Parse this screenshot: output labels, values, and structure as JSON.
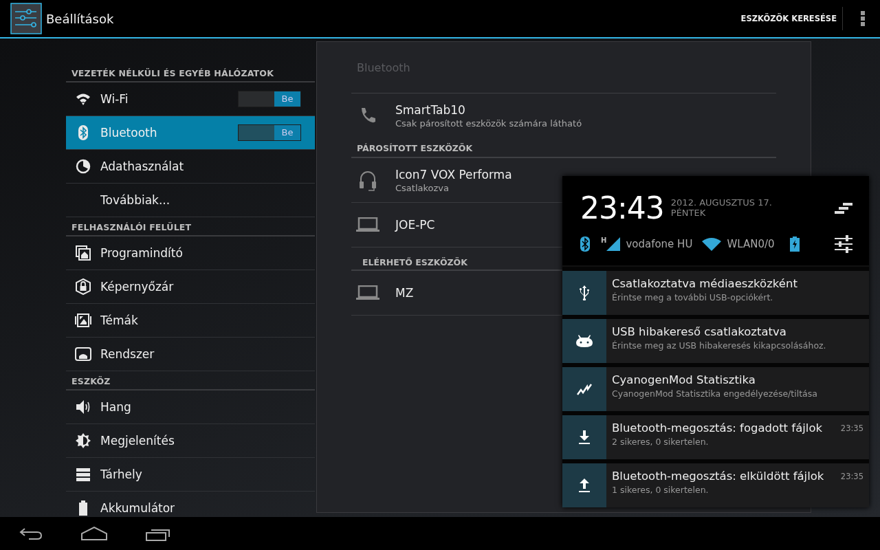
{
  "action_bar": {
    "title": "Beállítások",
    "action": "ESZKÖZÖK KERESÉSE"
  },
  "sidebar": [
    {
      "kind": "header",
      "label": "VEZETÉK NÉLKÜLI ÉS EGYÉB HÁLÓZATOK"
    },
    {
      "kind": "item",
      "label": "Wi-Fi",
      "selected": false,
      "switch": {
        "label": "Be",
        "on": true
      }
    },
    {
      "kind": "item",
      "label": "Bluetooth",
      "selected": true,
      "switch": {
        "label": "Be",
        "on": true
      }
    },
    {
      "kind": "item",
      "label": "Adathasználat",
      "selected": false
    },
    {
      "kind": "item",
      "label": "Továbbiak...",
      "selected": false
    },
    {
      "kind": "header",
      "label": "FELHASZNÁLÓI FELÜLET"
    },
    {
      "kind": "item",
      "label": "Programindító",
      "selected": false
    },
    {
      "kind": "item",
      "label": "Képernyőzár",
      "selected": false
    },
    {
      "kind": "item",
      "label": "Témák",
      "selected": false
    },
    {
      "kind": "item",
      "label": "Rendszer",
      "selected": false
    },
    {
      "kind": "header",
      "label": "ESZKÖZ"
    },
    {
      "kind": "item",
      "label": "Hang",
      "selected": false
    },
    {
      "kind": "item",
      "label": "Megjelenítés",
      "selected": false
    },
    {
      "kind": "item",
      "label": "Tárhely",
      "selected": false
    },
    {
      "kind": "item",
      "label": "Akkumulátor",
      "selected": false
    }
  ],
  "detail": {
    "title": "Bluetooth",
    "own_device": {
      "name": "SmartTab10",
      "status": "Csak párosított eszközök számára látható"
    },
    "sections": [
      {
        "header": "PÁROSÍTOTT ESZKÖZÖK",
        "devices": [
          {
            "name": "Icon7 VOX Performa",
            "status": "Csatlakozva"
          },
          {
            "name": "JOE-PC"
          }
        ]
      },
      {
        "header": "ELÉRHETŐ ESZKÖZÖK",
        "devices": [
          {
            "name": "MZ"
          }
        ]
      }
    ]
  },
  "notification_shade": {
    "time": "23:43",
    "date": "2012. AUGUSZTUS 17.",
    "weekday": "PÉNTEK",
    "carrier": "vodafone HU",
    "network_type": "H",
    "wifi": "WLAN0/0",
    "notifications": [
      {
        "title": "Csatlakoztatva médiaeszközként",
        "text": "Érintse meg a további USB-opciókért."
      },
      {
        "title": "USB hibakereső csatlakoztatva",
        "text": "Érintse meg az USB hibakeresés kikapcsolásához."
      },
      {
        "title": "CyanogenMod Statisztika",
        "text": "CyanogenMod Statisztika engedélyezése/tiltása"
      },
      {
        "title": "Bluetooth-megosztás: fogadott fájlok",
        "text": "2 sikeres, 0 sikertelen.",
        "time": "23:35"
      },
      {
        "title": "Bluetooth-megosztás: elküldött fájlok",
        "text": "1 sikeres, 0 sikertelen.",
        "time": "23:35"
      }
    ]
  }
}
